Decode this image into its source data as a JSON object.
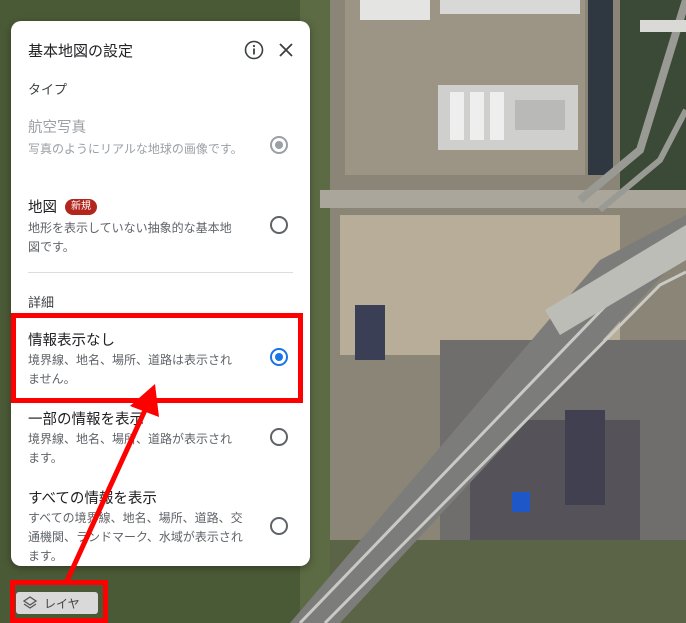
{
  "panel": {
    "title": "基本地図の設定",
    "type_section_label": "タイプ",
    "detail_section_label": "詳細",
    "type_options": [
      {
        "title": "航空写真",
        "description": "写真のようにリアルな地球の画像です。",
        "state": "selected-disabled"
      },
      {
        "title": "地図",
        "badge": "新規",
        "description": "地形を表示していない抽象的な基本地図です。",
        "state": "unselected"
      }
    ],
    "detail_options": [
      {
        "title": "情報表示なし",
        "description": "境界線、地名、場所、道路は表示されません。",
        "state": "selected"
      },
      {
        "title": "一部の情報を表示",
        "description": "境界線、地名、場所、道路が表示されます。",
        "state": "unselected"
      },
      {
        "title": "すべての情報を表示",
        "description": "すべての境界線、地名、場所、道路、交通機関、ランドマーク、水域が表示されます。",
        "state": "unselected"
      }
    ]
  },
  "layer_button": {
    "label": "レイヤ"
  },
  "icons": {
    "info": "info-icon",
    "close": "close-icon",
    "layers": "layers-icon"
  },
  "colors": {
    "selected_radio": "#1a73e8",
    "annotation": "#ff0000",
    "badge": "#b3261e"
  }
}
